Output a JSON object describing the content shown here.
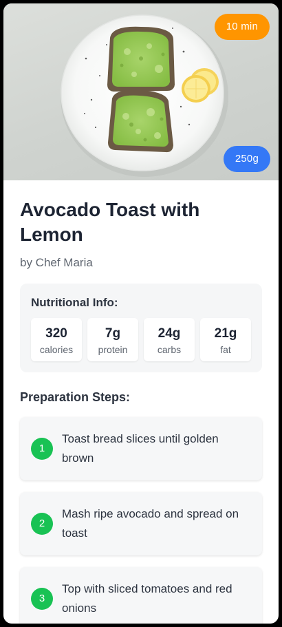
{
  "recipe": {
    "title": "Avocado Toast with Lemon",
    "author": "by Chef Maria",
    "time_badge": "10 min",
    "weight_badge": "250g"
  },
  "nutrition": {
    "title": "Nutritional Info:",
    "items": [
      {
        "value": "320",
        "label": "calories"
      },
      {
        "value": "7g",
        "label": "protein"
      },
      {
        "value": "24g",
        "label": "carbs"
      },
      {
        "value": "21g",
        "label": "fat"
      }
    ]
  },
  "steps": {
    "title": "Preparation Steps:",
    "items": [
      {
        "number": "1",
        "text": "Toast bread slices until golden brown"
      },
      {
        "number": "2",
        "text": "Mash ripe avocado and spread on toast"
      },
      {
        "number": "3",
        "text": "Top with sliced tomatoes and red onions"
      }
    ]
  },
  "colors": {
    "time_badge": "#ff9500",
    "weight_badge": "#3478f6",
    "step_number": "#19c254"
  }
}
